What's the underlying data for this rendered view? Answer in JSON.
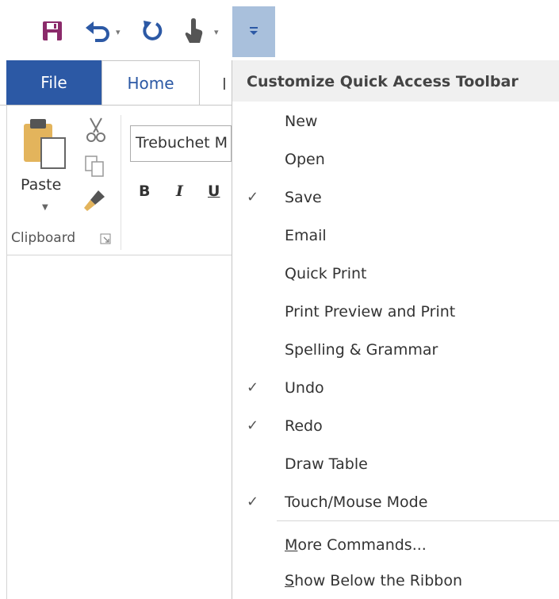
{
  "quick_access": {
    "items": [
      "save-icon",
      "undo-icon",
      "redo-icon",
      "touch-mouse-mode-icon",
      "customize-toolbar-icon"
    ]
  },
  "ribbon": {
    "tabs": {
      "file": "File",
      "home": "Home",
      "next_partial": "I"
    },
    "clipboard": {
      "paste_label": "Paste",
      "group_label": "Clipboard"
    },
    "font": {
      "name": "Trebuchet M",
      "bold": "B",
      "italic": "I",
      "underline": "U"
    }
  },
  "menu": {
    "title": "Customize Quick Access Toolbar",
    "check_glyph": "✓",
    "items": [
      {
        "label": "New",
        "checked": false
      },
      {
        "label": "Open",
        "checked": false
      },
      {
        "label": "Save",
        "checked": true
      },
      {
        "label": "Email",
        "checked": false
      },
      {
        "label": "Quick Print",
        "checked": false
      },
      {
        "label": "Print Preview and Print",
        "checked": false
      },
      {
        "label": "Spelling & Grammar",
        "checked": false
      },
      {
        "label": "Undo",
        "checked": true
      },
      {
        "label": "Redo",
        "checked": true
      },
      {
        "label": "Draw Table",
        "checked": false
      },
      {
        "label": "Touch/Mouse Mode",
        "checked": true
      }
    ],
    "more_commands": {
      "accel": "M",
      "rest": "ore Commands..."
    },
    "show_below": {
      "accel": "S",
      "rest": "how Below the Ribbon"
    }
  },
  "colors": {
    "file_tab": "#2c59a5",
    "customize_active": "#a9c0dc",
    "save_icon": "#8b2a6a",
    "undo_blue": "#2c59a5"
  }
}
